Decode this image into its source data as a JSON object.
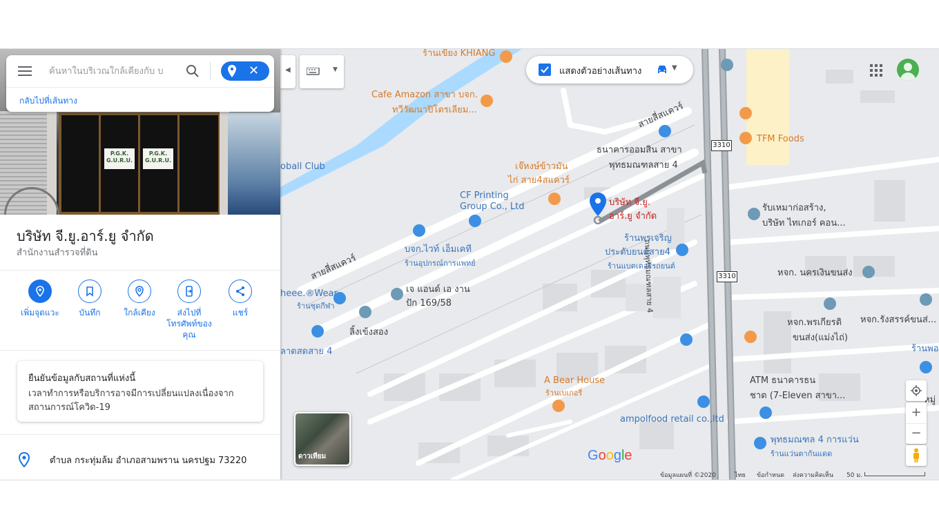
{
  "search": {
    "placeholder": "ค้นหาในบริเวณใกล้เคียงกับ บ",
    "back_link": "กลับไปที่เส้นทาง"
  },
  "photo": {
    "sign_left": "P.G.K.\nG.U.R.U.",
    "sign_right": "P.G.K.\nG.U.R.U."
  },
  "place": {
    "name": "บริษัท จี.ยู.อาร์.ยู จำกัด",
    "category": "สำนักงานสำรวจที่ดิน"
  },
  "actions": [
    {
      "label": "เพิ่มจุดแวะ",
      "icon": "add-stop-icon"
    },
    {
      "label": "บันทึก",
      "icon": "bookmark-icon"
    },
    {
      "label": "ใกล้เคียง",
      "icon": "nearby-icon"
    },
    {
      "label": "ส่งไปที่โทรศัพท์ของคุณ",
      "icon": "send-to-phone-icon"
    },
    {
      "label": "แชร์",
      "icon": "share-icon"
    }
  ],
  "verify": {
    "title": "ยืนยันข้อมูลกับสถานที่แห่งนี้",
    "desc": "เวลาทำการหรือบริการอาจมีการเปลี่ยนแปลงเนื่องจากสถานการณ์โควิด-19"
  },
  "address": "ตำบล กระทุ่มล้ม อำเภอสามพราน นครปฐม 73220",
  "map": {
    "route_toggle_label": "แสดงตัวอย่างเส้นทาง",
    "satellite_label": "ดาวเทียม",
    "google_logo": "Google",
    "labels": {
      "khiang": "ร้านเขียง KHIANG",
      "cafe_amazon": "Cafe Amazon สาขา บจก.",
      "cafe_amazon_2": "ทวีวัฒนาปิโตรเลียม...",
      "football": "oball Club",
      "tfm": "TFM Foods",
      "road_sai4_a": "สายสี่สแควร์",
      "road_sai4_b": "สายสี่สแควร์",
      "gsb": "ธนาคารออมสิน สาขา",
      "gsb_2": "พุทธมณฑลสาย 4",
      "jaehong": "เจ๊หงษ์ข้าวมัน",
      "jaehong_2": "ไก่ สาย4สแควร์",
      "cf": "CF Printing",
      "cf_2": "Group Co., Ltd",
      "guru": "บริษัท จี.ยู.",
      "guru_2": "อาร์.ยู จำกัด",
      "rubmaw": "รับเหมาก่อสร้าง,",
      "rubmaw_2": "บริษัท ไทเกอร์ คอน...",
      "white_med": "บจก.ไวท์ เอ็มเคที",
      "white_med_2": "ร้านอุปกรณ์การแพทย์",
      "pornjaroen": "ร้านพรเจริญ",
      "pornjaroen_2": "ประดับยนต์สาย4",
      "pornjaroen_3": "ร้านแบตเตอรี่รถยนต์",
      "ngaen": "หจก. นครเงินขนส่ง",
      "wear": "heee.®Wear",
      "wear_2": "ร้านชุดกีฬา",
      "jand": "เจ แอนด์ เอ งาน",
      "jand_2": "ปัก 169/58",
      "lingchang": "ลิ้งเข้งสอง",
      "market": "ลาดสดสาย 4",
      "pornkiat": "หจก.พรเกียรติ",
      "pornkiat_2": "ขนส่ง(แม่งไถ่)",
      "rungsan": "หจก.รังสรรค์ขนส่...",
      "rhanpo": "ร้านพอ",
      "bear": "A Bear House",
      "bear_2": "ร้านเบเกอรี่",
      "atm": "ATM ธนาคารธน",
      "atm_2": "ชาต (7-Eleven สาขา...",
      "ampolfood": "ampolfood retail co.,ltd",
      "phuttha4": "พุทธมณฑล 4 การแว่น",
      "phuttha4_2": "ร้านแว่นตากันแดด",
      "main_road": "ถนนพุทธมณฑลสาย 4",
      "moo": "หมู่"
    },
    "shields": [
      "3310",
      "3310"
    ]
  },
  "footer": {
    "data": "ข้อมูลแผนที่ ©2020",
    "lang": "ไทย",
    "terms": "ข้อกำหนด",
    "feedback": "ส่งความคิดเห็น",
    "scale": "50 ม."
  }
}
